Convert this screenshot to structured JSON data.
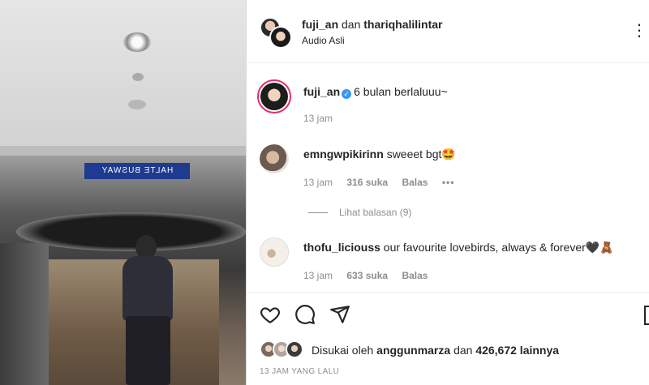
{
  "header": {
    "user1": "fuji_an",
    "connector": "dan",
    "user2": "thariqhalilintar",
    "subtitle": "Audio Asli",
    "more": "⋮"
  },
  "caption": {
    "username": "fuji_an",
    "text": "6 bulan berlaluuu~",
    "time": "13 jam"
  },
  "comments": [
    {
      "username": "emngwpikirinn",
      "text": "sweeet bgt🤩",
      "time": "13 jam",
      "likes": "316 suka",
      "reply": "Balas",
      "more": "•••",
      "view_replies": "Lihat balasan (9)"
    },
    {
      "username": "thofu_liciouss",
      "text": "our favourite lovebirds, always & forever🖤🧸",
      "time": "13 jam",
      "likes": "633 suka",
      "reply": "Balas"
    }
  ],
  "likes": {
    "prefix": "Disukai oleh",
    "user": "anggunmarza",
    "connector": "dan",
    "count": "426,672 lainnya"
  },
  "timestamp": "13 JAM YANG LALU",
  "media": {
    "sign_text": "HALTE BUSWAY"
  },
  "icons": {
    "like": "heart-icon",
    "comment": "comment-icon",
    "share": "share-icon",
    "save": "bookmark-icon"
  }
}
